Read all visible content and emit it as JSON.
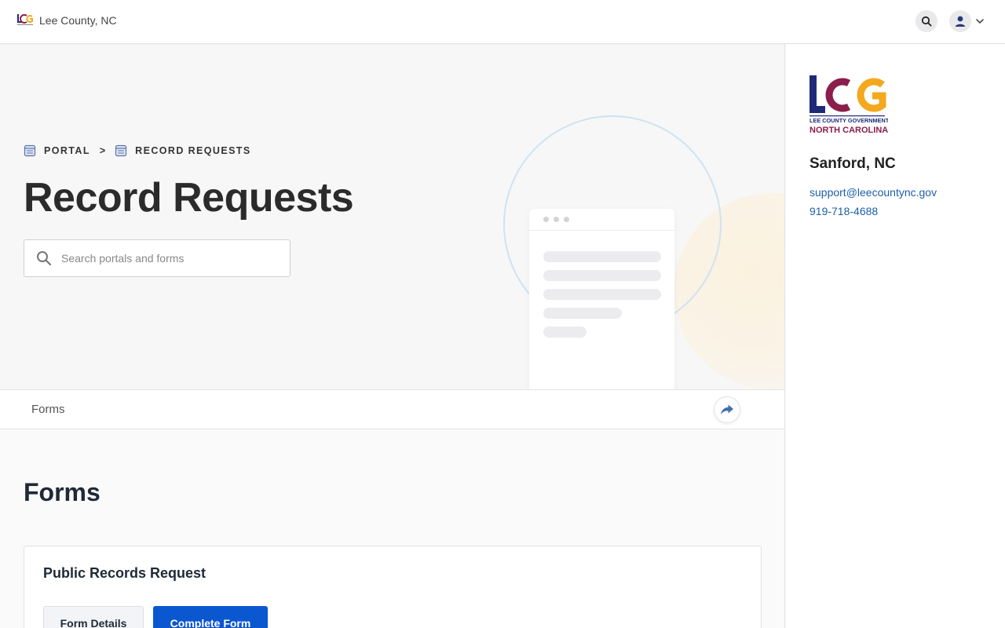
{
  "header": {
    "site_name": "Lee County, NC",
    "search_icon": "search-icon",
    "user_icon": "user-icon"
  },
  "breadcrumb": [
    {
      "label": "PORTAL"
    },
    {
      "label": "RECORD REQUESTS"
    }
  ],
  "breadcrumb_separator": ">",
  "hero": {
    "title": "Record Requests",
    "search_placeholder": "Search portals and forms"
  },
  "subnav": {
    "link": "Forms",
    "share_icon": "share-icon"
  },
  "forms_section": {
    "title": "Forms",
    "items": [
      {
        "title": "Public Records Request",
        "details_label": "Form Details",
        "complete_label": "Complete Form"
      }
    ]
  },
  "sidebar": {
    "logo": {
      "letters": "LCG",
      "line1": "LEE COUNTY GOVERNMENT",
      "line2": "NORTH CAROLINA"
    },
    "city": "Sanford, NC",
    "email": "support@leecountync.gov",
    "phone": "919-718-4688"
  },
  "colors": {
    "brand_navy": "#1e2a78",
    "brand_maroon": "#8b1e4b",
    "brand_orange": "#f4a81d",
    "primary_button": "#0b57d0",
    "link": "#1d5fa8"
  }
}
